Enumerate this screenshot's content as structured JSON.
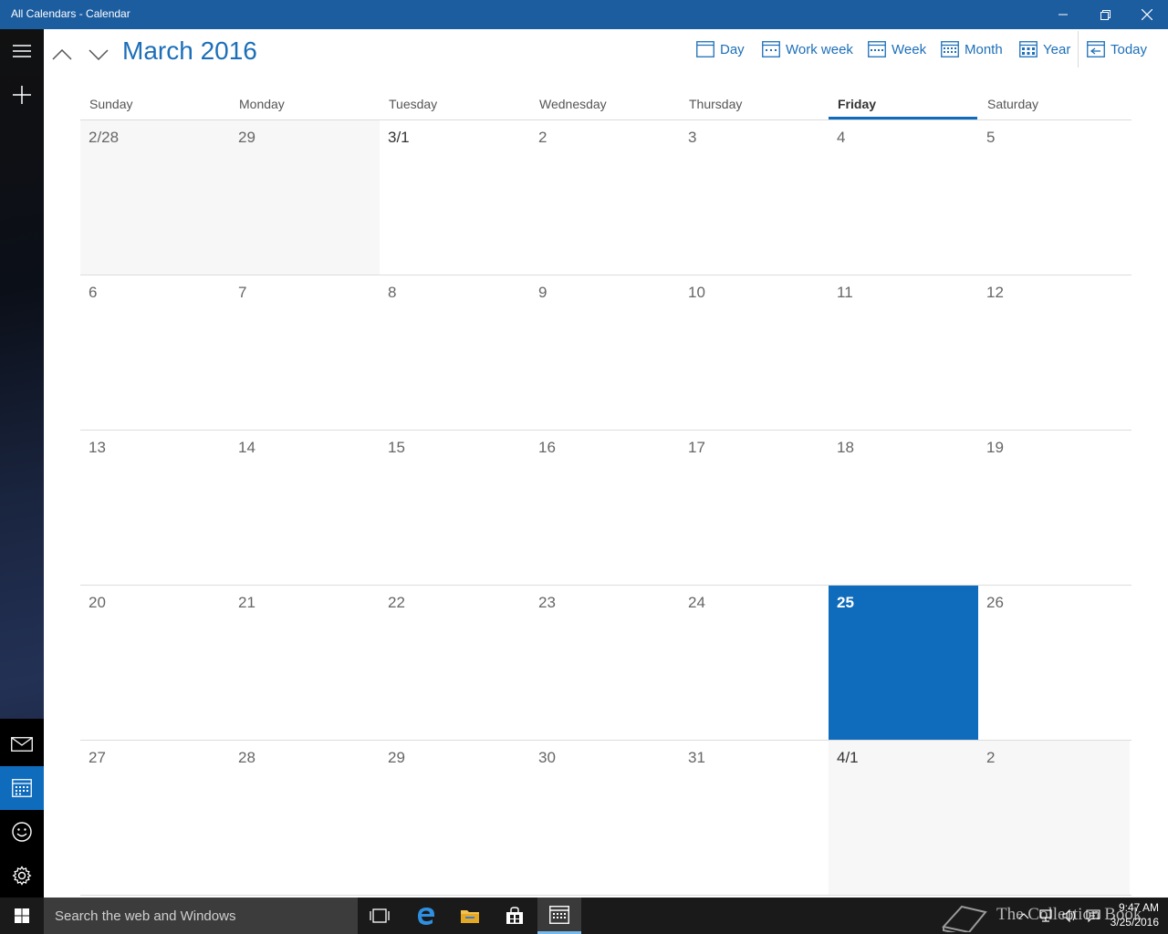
{
  "window": {
    "title": "All Calendars - Calendar"
  },
  "header": {
    "month_title": "March 2016",
    "views": [
      {
        "label": "Day",
        "icon": "day-view-icon"
      },
      {
        "label": "Work week",
        "icon": "work-week-view-icon"
      },
      {
        "label": "Week",
        "icon": "week-view-icon"
      },
      {
        "label": "Month",
        "icon": "month-view-icon"
      },
      {
        "label": "Year",
        "icon": "year-view-icon"
      },
      {
        "label": "Today",
        "icon": "today-icon"
      }
    ]
  },
  "calendar": {
    "weekdays": [
      "Sunday",
      "Monday",
      "Tuesday",
      "Wednesday",
      "Thursday",
      "Friday",
      "Saturday"
    ],
    "today_weekday_index": 5,
    "weeks": [
      [
        "2/28",
        "29",
        "3/1",
        "2",
        "3",
        "4",
        "5"
      ],
      [
        "6",
        "7",
        "8",
        "9",
        "10",
        "11",
        "12"
      ],
      [
        "13",
        "14",
        "15",
        "16",
        "17",
        "18",
        "19"
      ],
      [
        "20",
        "21",
        "22",
        "23",
        "24",
        "25",
        "26"
      ],
      [
        "27",
        "28",
        "29",
        "30",
        "31",
        "4/1",
        "2"
      ]
    ],
    "today": {
      "week": 3,
      "day": 5
    }
  },
  "taskbar": {
    "search_placeholder": "Search the web and Windows",
    "watermark": "The Collection Book",
    "time": "9:47 AM",
    "date": "3/25/2016"
  },
  "colors": {
    "accent": "#0f6cbd",
    "titlebar": "#1c5da0",
    "month_title": "#1c6fb8"
  }
}
